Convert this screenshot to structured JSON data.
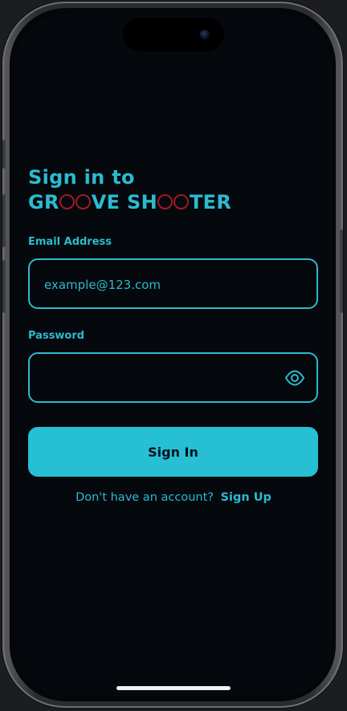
{
  "signin_screen": {
    "title_line1": "Sign in to",
    "brand_parts": [
      "GR",
      "VE SH",
      "TER"
    ],
    "email_label": "Email Address",
    "email_placeholder": "example@123.com",
    "password_label": "Password",
    "password_value": "",
    "signin_button": "Sign In",
    "footer_prompt": "Don't have an account?",
    "footer_link": "Sign Up"
  },
  "icons": {
    "password_toggle": "eye-icon",
    "brand_o": "red-ring-o"
  },
  "colors": {
    "accent": "#2bbbd0",
    "button": "#27bfd3",
    "background": "#05080d",
    "brand_ring": "#a11c22"
  }
}
